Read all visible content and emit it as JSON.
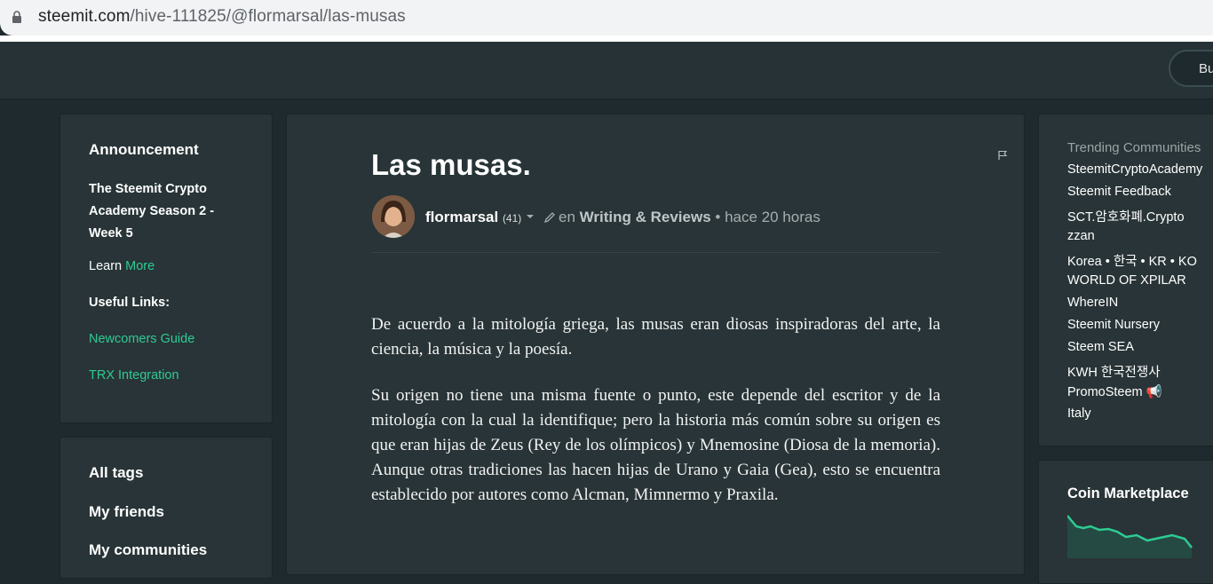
{
  "browser": {
    "url_host": "steemit.com",
    "url_path": "/hive-111825/@flormarsal/las-musas"
  },
  "header": {
    "button_label": "Bu"
  },
  "left_sidebar": {
    "announcement_title": "Announcement",
    "announcement_text": "The Steemit Crypto Academy Season 2 - Week 5",
    "learn_label": "Learn",
    "learn_more": "More",
    "useful_links_title": "Useful Links:",
    "links": [
      "Newcomers Guide",
      "TRX Integration"
    ],
    "nav_items": [
      "All tags",
      "My friends",
      "My communities"
    ]
  },
  "post": {
    "title": "Las musas.",
    "author": "flormarsal",
    "reputation": "(41)",
    "in_label": "en",
    "community": "Writing & Reviews",
    "time_separator": "•",
    "time": "hace 20 horas",
    "paragraphs": [
      "De acuerdo a la mitología griega, las musas eran diosas inspiradoras del arte, la ciencia, la música y la poesía.",
      "Su origen no tiene una misma fuente o punto, este depende del escritor y de la mitología con la cual la identifique; pero la historia más común sobre su origen es que eran hijas de Zeus (Rey de los olímpicos) y Mnemosine (Diosa de la memoria). Aunque otras tradiciones las hacen hijas de Urano y Gaia (Gea), esto se encuentra establecido por autores como Alcman, Mimnermo y Praxila."
    ]
  },
  "right_sidebar": {
    "trending_title": "Trending Communities",
    "communities": [
      "SteemitCryptoAcademy",
      "Steemit Feedback",
      "SCT.암호화폐.Crypto",
      "zzan",
      "Korea • 한국 • KR • KO",
      "WORLD OF XPILAR",
      "WhereIN",
      "Steemit Nursery",
      "Steem SEA",
      "KWH 한국전쟁사",
      "PromoSteem 📢",
      "Italy"
    ],
    "market_title": "Coin Marketplace"
  },
  "colors": {
    "accent": "#2ecb93",
    "background": "#1f2a2e",
    "card": "#283437"
  }
}
